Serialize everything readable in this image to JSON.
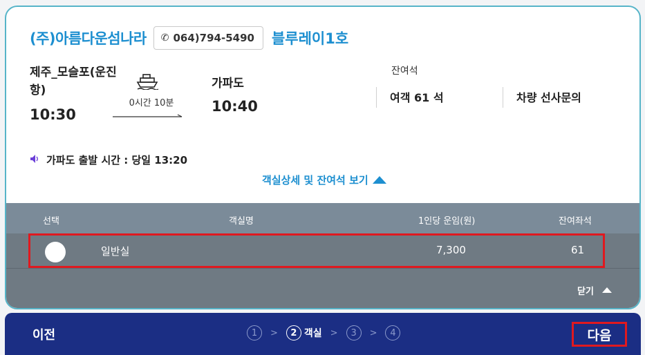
{
  "header": {
    "company": "(주)아름다운섬나라",
    "phone": "064)794-5490",
    "ship": "블루레이1호"
  },
  "route": {
    "departure_name": "제주_모슬포(운진항)",
    "departure_time": "10:30",
    "duration": "0시간 10분",
    "arrival_name": "가파도",
    "arrival_time": "10:40"
  },
  "seats": {
    "label": "잔여석",
    "passenger": "여객 61 석",
    "vehicle": "차량 선사문의"
  },
  "notice": "가파도 출발 시간 : 당일 13:20",
  "detail_link": "객실상세 및 잔여석 보기",
  "table": {
    "headers": [
      "선택",
      "객실명",
      "1인당 운임(원)",
      "잔여좌석"
    ],
    "rows": [
      {
        "room": "일반실",
        "fare": "7,300",
        "remaining": "61"
      }
    ],
    "close_label": "닫기"
  },
  "footer": {
    "prev_label": "이전",
    "steps": [
      {
        "num": "①",
        "label": ""
      },
      {
        "num": "②",
        "label": "객실"
      },
      {
        "num": "③",
        "label": ""
      },
      {
        "num": "④",
        "label": ""
      }
    ],
    "next_label": "다음"
  },
  "icons": {
    "phone": "phone-icon",
    "ferry": "ferry-icon",
    "speaker": "speaker-icon",
    "triangle_up": "triangle-up-icon"
  },
  "colors": {
    "accent": "#1d8fd0",
    "footer_bg": "#1b2e84",
    "highlight": "#e0191f",
    "table_header": "#7b8b99",
    "table_row": "#6f7a83"
  }
}
